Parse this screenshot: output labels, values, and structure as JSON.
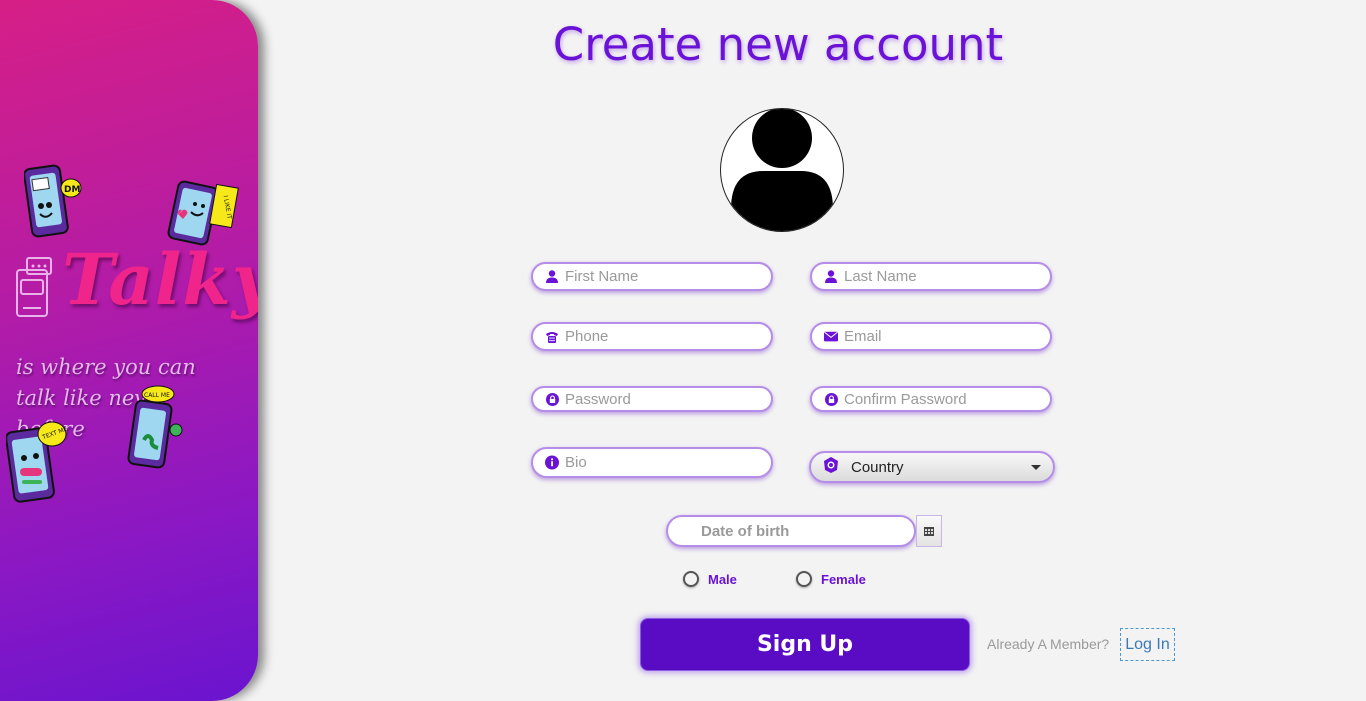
{
  "brand": {
    "logo": "Talky",
    "tagline": "is where you can talk like never before",
    "sticker_dm": "DM",
    "sticker_like": "I LIKE IT",
    "sticker_call": "CALL ME",
    "sticker_text": "TEXT ME"
  },
  "form": {
    "title": "Create new account",
    "first_name_placeholder": "First Name",
    "last_name_placeholder": "Last Name",
    "phone_placeholder": "Phone",
    "email_placeholder": "Email",
    "password_placeholder": "Password",
    "confirm_password_placeholder": "Confirm Password",
    "bio_placeholder": "Bio",
    "country_label": "Country",
    "dob_placeholder": "Date of birth",
    "gender_male": "Male",
    "gender_female": "Female",
    "signup_label": "Sign Up",
    "already_member": "Already A Member?",
    "login_label": "Log In"
  },
  "colors": {
    "accent": "#6a12d6",
    "button": "#5a0cc5",
    "brand_pink": "#f0258c"
  }
}
